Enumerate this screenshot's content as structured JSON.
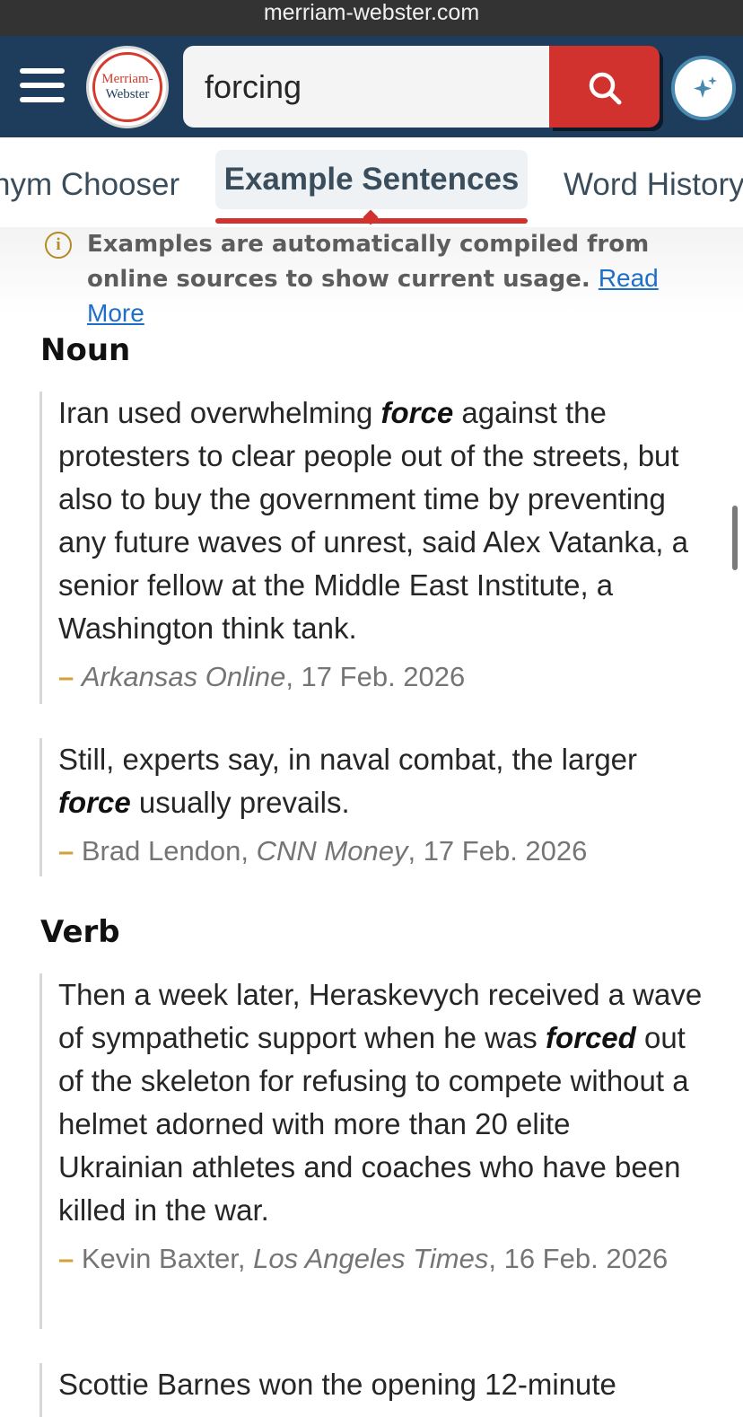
{
  "browser": {
    "url": "merriam-webster.com"
  },
  "header": {
    "logo_line1": "Merriam-",
    "logo_line2": "Webster",
    "search_value": "forcing"
  },
  "tabs": [
    {
      "label": "Synonym Chooser",
      "visible_label": "nym Chooser"
    },
    {
      "label": "Example Sentences"
    },
    {
      "label": "Word History"
    }
  ],
  "info": {
    "text": "Examples are automatically compiled from online sources to show current usage.",
    "link": "Read More"
  },
  "sections": [
    {
      "heading": "Noun",
      "examples": [
        {
          "before": "Iran used overwhelming ",
          "keyword": "force",
          "after": " against the protesters to clear people out of the streets, but also to buy the government time by preventing any future waves of unrest, said Alex Vatanka, a senior fellow at the Middle East Institute, a Washington think tank.",
          "author": "",
          "publication": "Arkansas Online",
          "date": ", 17 Feb. 2026"
        },
        {
          "before": "Still, experts say, in naval combat, the larger ",
          "keyword": "force",
          "after": " usually prevails.",
          "author": "Brad Lendon, ",
          "publication": "CNN Money",
          "date": ", 17 Feb. 2026"
        }
      ]
    },
    {
      "heading": "Verb",
      "examples": [
        {
          "before": "Then a week later, Heraskevych received a wave of sympathetic support when he was ",
          "keyword": "forced",
          "after": " out of the skeleton for refusing to compete without a helmet adorned with more than 20 elite Ukrainian athletes and coaches who have been killed in the war.",
          "author": "Kevin Baxter, ",
          "publication": "Los Angeles Times",
          "date": ", 16 Feb. 2026"
        },
        {
          "before": "Scottie Barnes won the opening 12-minute",
          "keyword": "",
          "after": "",
          "author": "",
          "publication": "",
          "date": ""
        }
      ]
    }
  ],
  "dash": "–"
}
